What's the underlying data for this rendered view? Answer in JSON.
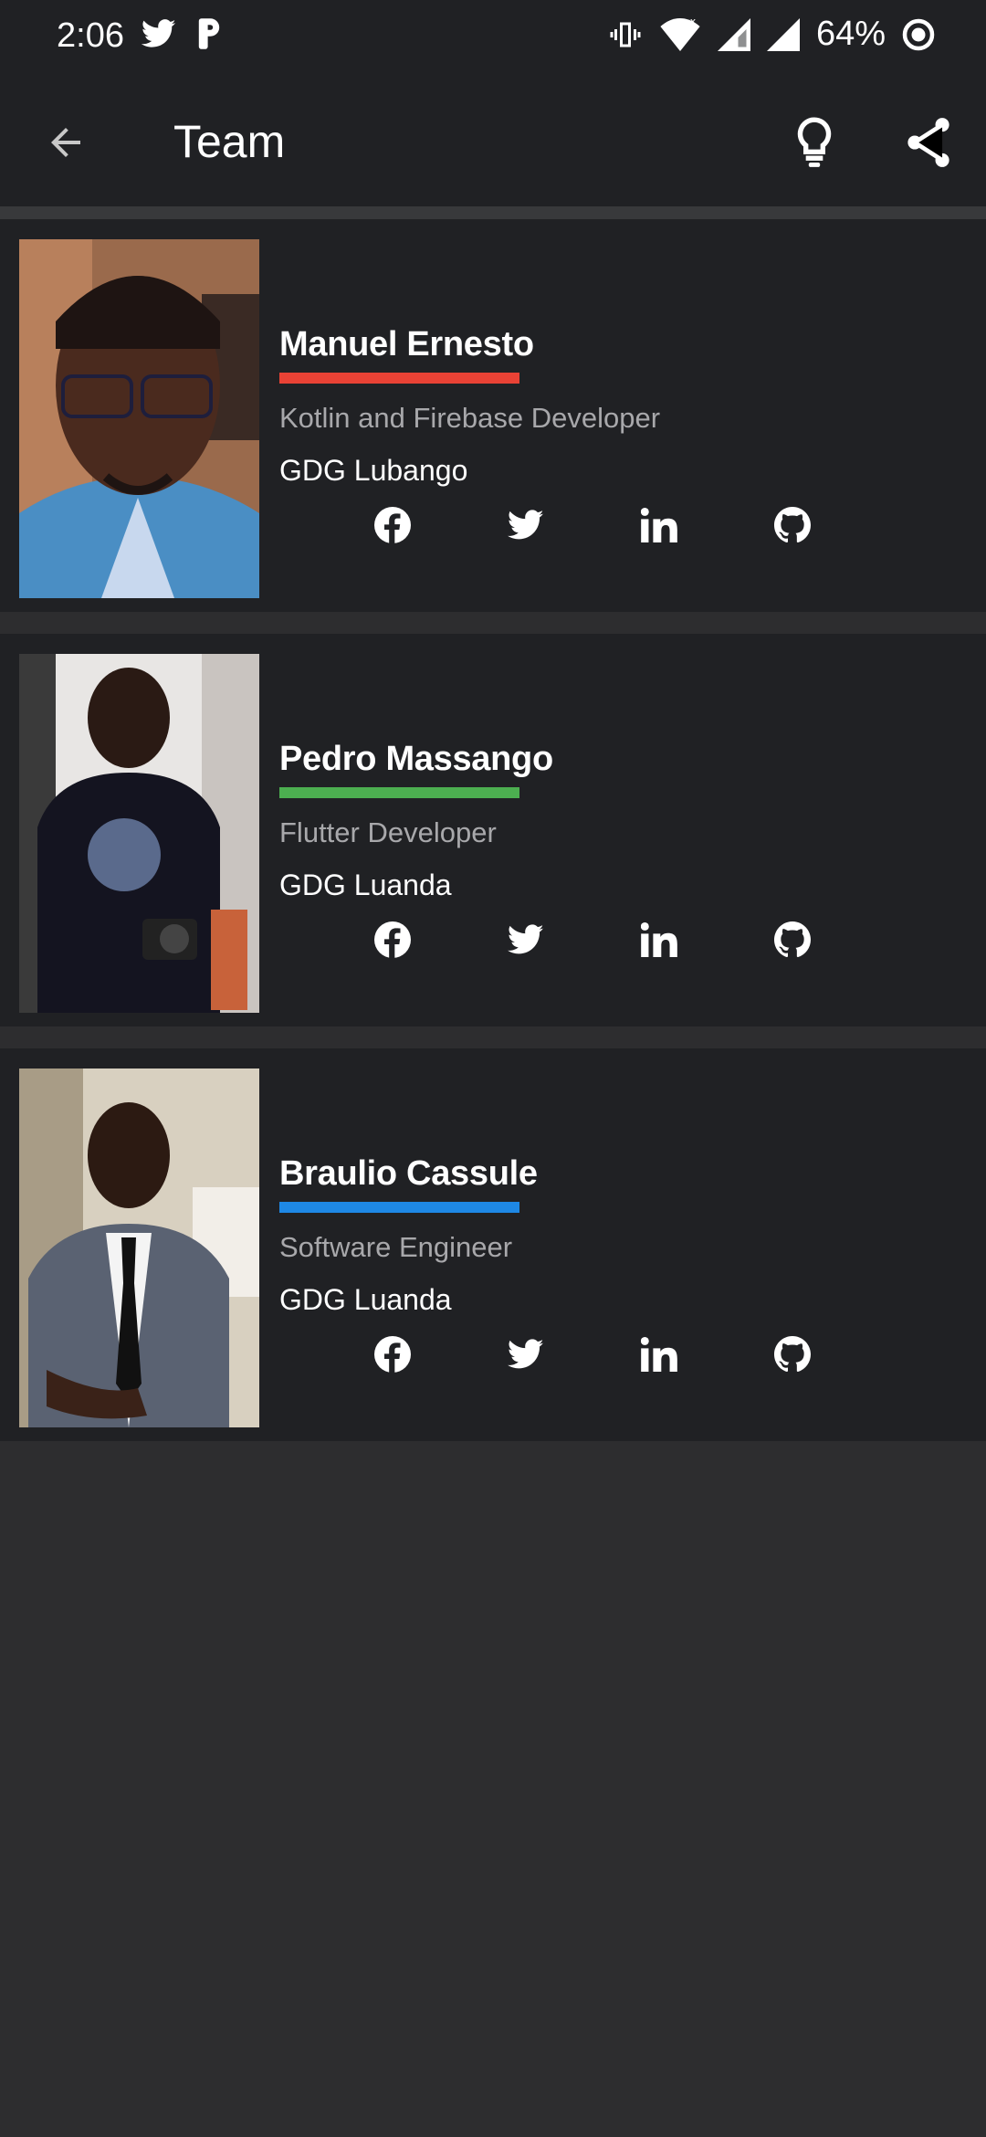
{
  "status": {
    "time": "2:06",
    "battery": "64%"
  },
  "appbar": {
    "title": "Team"
  },
  "team": [
    {
      "name": "Manuel Ernesto",
      "role": "Kotlin and Firebase Developer",
      "org": "GDG Lubango",
      "accent": "#e94235"
    },
    {
      "name": "Pedro Massango",
      "role": "Flutter Developer",
      "org": "GDG Luanda",
      "accent": "#4caf50"
    },
    {
      "name": "Braulio Cassule",
      "role": "Software Engineer",
      "org": "GDG Luanda",
      "accent": "#1e88e5"
    }
  ],
  "icons": {
    "facebook": "facebook-icon",
    "twitter": "twitter-icon",
    "linkedin": "linkedin-icon",
    "github": "github-icon"
  }
}
